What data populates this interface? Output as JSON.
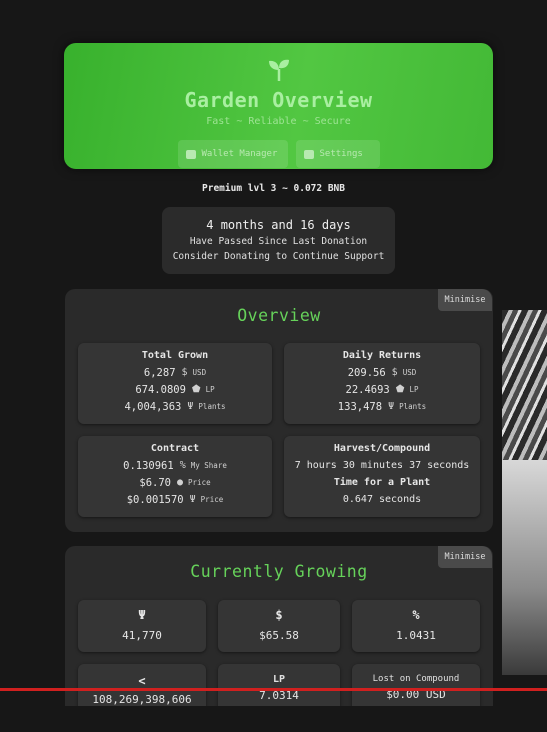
{
  "header": {
    "title": "Garden Overview",
    "subtitle": "Fast ~ Reliable ~ Secure",
    "wallet_button": "Wallet Manager",
    "settings_button": "Settings",
    "accent": "#4cc23f"
  },
  "premium": "Premium lvl 3 ~ 0.072 BNB",
  "donation": {
    "line1": "4 months and 16 days",
    "line2": "Have Passed Since Last Donation",
    "line3": "Consider Donating to Continue Support"
  },
  "overview": {
    "title": "Overview",
    "minimise": "Minimise",
    "total_grown": {
      "heading": "Total Grown",
      "rows": [
        {
          "value": "6,287",
          "symbol": "$",
          "unit": "USD"
        },
        {
          "value": "674.0809",
          "symbol": "LP-icon",
          "unit": "LP"
        },
        {
          "value": "4,004,363",
          "symbol": "sprout-icon",
          "unit": "Plants"
        }
      ]
    },
    "daily_returns": {
      "heading": "Daily Returns",
      "rows": [
        {
          "value": "209.56",
          "symbol": "$",
          "unit": "USD"
        },
        {
          "value": "22.4693",
          "symbol": "LP-icon",
          "unit": "LP"
        },
        {
          "value": "133,478",
          "symbol": "sprout-icon",
          "unit": "Plants"
        }
      ]
    },
    "contract": {
      "heading": "Contract",
      "rows": [
        {
          "value": "0.130961",
          "symbol": "%",
          "unit": "My Share"
        },
        {
          "value": "$6.70",
          "symbol": "drop-icon",
          "unit": "Price"
        },
        {
          "value": "$0.001570",
          "symbol": "sprout-icon",
          "unit": "Price"
        }
      ]
    },
    "harvest": {
      "heading": "Harvest/Compound",
      "time": "7 hours 30 minutes 37 seconds",
      "plant_heading": "Time for a Plant",
      "plant_time": "0.647 seconds"
    }
  },
  "growing": {
    "title": "Currently Growing",
    "minimise": "Minimise",
    "cards": [
      {
        "icon": "sprout-icon",
        "value": "41,770"
      },
      {
        "icon": "$",
        "value": "$65.58"
      },
      {
        "icon": "%",
        "value": "1.0431"
      },
      {
        "icon": "share-icon",
        "value": "108,269,398,606"
      },
      {
        "label": "LP",
        "value": "7.0314"
      },
      {
        "label": "Lost on Compound",
        "value": "$0.00 USD"
      }
    ]
  }
}
